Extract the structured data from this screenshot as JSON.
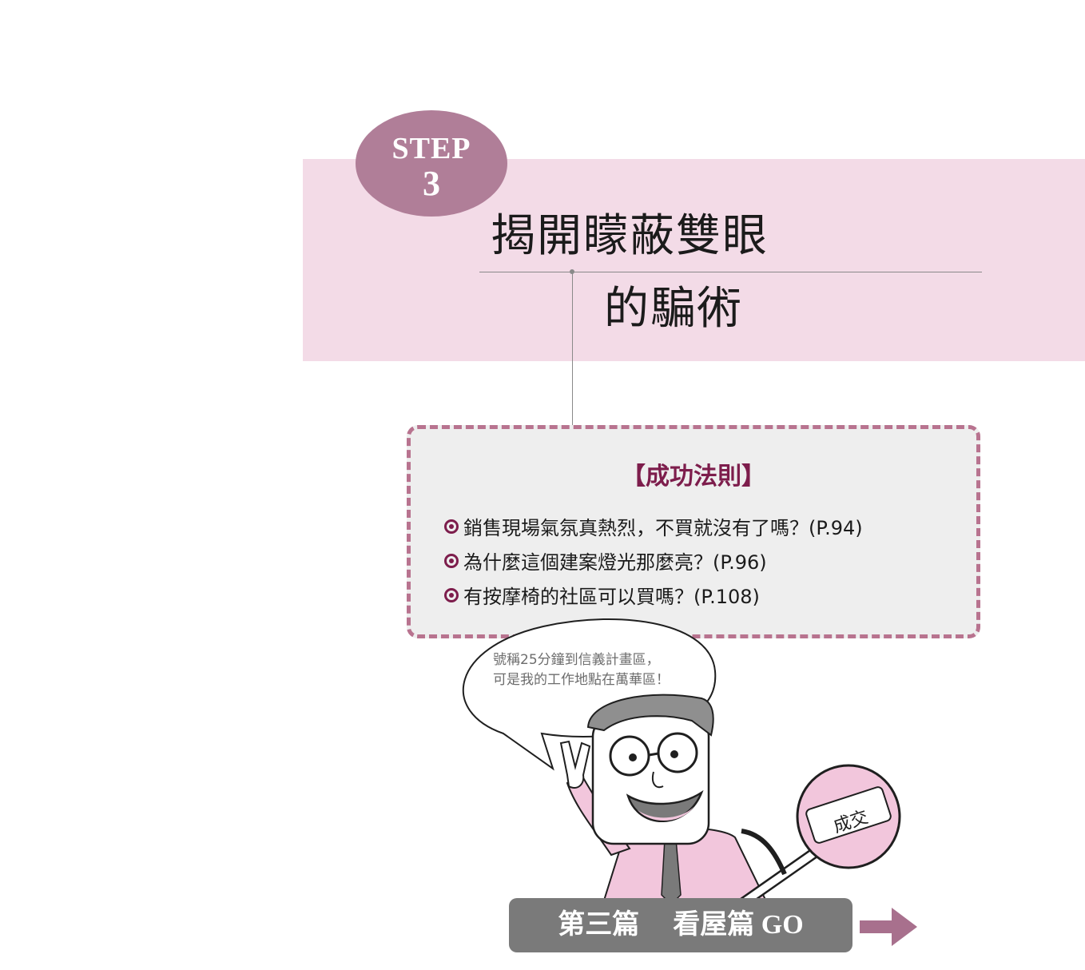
{
  "step": {
    "word": "STEP",
    "number": "3"
  },
  "title": {
    "line1": "揭開矇蔽雙眼",
    "line2": "的騙術"
  },
  "rules": {
    "heading": "【成功法則】",
    "items": [
      {
        "text": "銷售現場氣氛真熱烈，不買就沒有了嗎？(P.94)"
      },
      {
        "text": "為什麼這個建案燈光那麼亮？(P.96)"
      },
      {
        "text": "有按摩椅的社區可以買嗎？(P.108)"
      }
    ]
  },
  "speech": {
    "line1": "號稱25分鐘到信義計畫區，",
    "line2": "可是我的工作地點在萬華區！"
  },
  "sign_text": "成交",
  "nav": {
    "part": "第三篇",
    "section": "看屋篇",
    "go": "GO"
  },
  "colors": {
    "banner": "#f3dbe7",
    "badge": "#b07e98",
    "accent": "#7d1d4c",
    "dashed_border": "#b8738f",
    "button": "#7a7a7a",
    "arrow": "#a8708d"
  }
}
